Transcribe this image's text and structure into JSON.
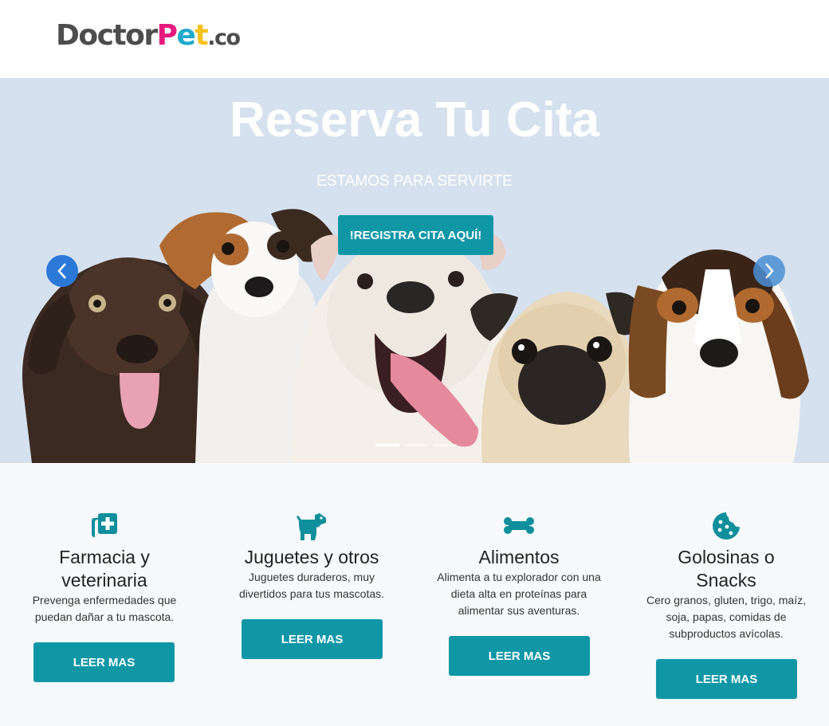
{
  "header": {
    "logo": {
      "part1": "Doctor",
      "part2": "P",
      "part3": "e",
      "part4": "t",
      "part5": ".co"
    }
  },
  "hero": {
    "title": "Reserva Tu Cita",
    "subtitle": "ESTAMOS PARA SERVIRTE",
    "cta_label": "!REGISTRA CITA AQUÍ!",
    "slides": {
      "count": 3,
      "active": 1
    }
  },
  "features": [
    {
      "icon": "pharmacy-icon",
      "title_line1": "Farmacia y",
      "title_line2": "veterinaria",
      "text_line1": "Prevenga enfermedades que",
      "text_line2": "puedan dañar a tu mascota.",
      "button": "LEER MAS"
    },
    {
      "icon": "dog-icon",
      "title_line1": "Juguetes y otros",
      "text_line1": "Juguetes duraderos, muy",
      "text_line2": "divertidos para tus mascotas.",
      "button": "LEER MAS"
    },
    {
      "icon": "bone-icon",
      "title_line1": "Alimentos",
      "text_line1": "Alimenta a tu explorador con una",
      "text_line2": "dieta alta en proteínas para",
      "text_line3": "alimentar sus aventuras.",
      "button": "LEER MAS"
    },
    {
      "icon": "cookie-icon",
      "title_line1": "Golosinas o",
      "title_line2": "Snacks",
      "text_line1": "Cero granos, gluten, trigo, maíz,",
      "text_line2": "soja, papas, comidas de",
      "text_line3": "subproductos avícolas.",
      "button": "LEER MAS"
    }
  ],
  "colors": {
    "accent": "#0f97a6",
    "hero_bg": "#d6e1ef",
    "arrow": "#2b78d8"
  }
}
